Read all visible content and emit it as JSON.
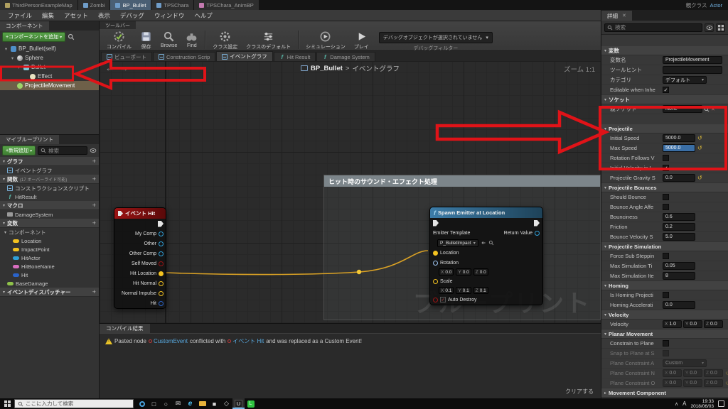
{
  "axis_labels": [
    "X",
    "Y",
    "Z"
  ],
  "titlebar": {
    "tabs": [
      {
        "label": "ThirdPersonExampleMap",
        "active": false,
        "icon_color": "#b0a060"
      },
      {
        "label": "Zombi",
        "active": false,
        "icon_color": "#6f9cc8"
      },
      {
        "label": "BP_Bullet",
        "active": true,
        "icon_color": "#6f9cc8"
      },
      {
        "label": "TPSChara",
        "active": false,
        "icon_color": "#6f9cc8"
      },
      {
        "label": "TPSChara_AnimBP",
        "active": false,
        "icon_color": "#c47ab0"
      }
    ],
    "parent_class_label": "親クラス",
    "parent_class_value": "Actor"
  },
  "menubar": {
    "items": [
      "ファイル",
      "編集",
      "アセット",
      "表示",
      "デバッグ",
      "ウィンドウ",
      "ヘルプ"
    ]
  },
  "components_panel": {
    "tab": "コンポーネント",
    "add_button": "+コンポーネントを追加",
    "tree": [
      {
        "label": "BP_Bullet(self)",
        "indent": 0,
        "icon": "blueprint",
        "arrow": true,
        "selected": false
      },
      {
        "label": "Sphere",
        "indent": 1,
        "icon": "sphere",
        "arrow": true,
        "selected": false
      },
      {
        "label": "Bullet",
        "indent": 2,
        "icon": "mesh",
        "arrow": true,
        "selected": false
      },
      {
        "label": "Effect",
        "indent": 3,
        "icon": "particle",
        "arrow": false,
        "selected": false
      },
      {
        "label": "ProjectileMovement",
        "indent": 1,
        "icon": "movement",
        "arrow": false,
        "selected": true
      }
    ]
  },
  "my_blueprint": {
    "tab": "マイブループリント",
    "add_button": "+新規追加",
    "search_placeholder": "検索",
    "sections": [
      {
        "title": "グラフ",
        "hint": "",
        "items": [
          {
            "label": "イベントグラフ",
            "kind": "graph"
          }
        ]
      },
      {
        "title": "関数",
        "hint": "(17 オーバーライド可能)",
        "items": [
          {
            "label": "コンストラクションスクリプト",
            "kind": "graph"
          },
          {
            "label": "HitResult",
            "kind": "fn"
          }
        ]
      },
      {
        "title": "マクロ",
        "hint": "",
        "items": [
          {
            "label": "DamageSystem",
            "kind": "macro"
          }
        ]
      },
      {
        "title": "変数",
        "hint": "",
        "items": [
          {
            "label": "コンポーネント",
            "kind": "category"
          },
          {
            "label": "Location",
            "kind": "pill",
            "color": "#f3c220",
            "indent": 1
          },
          {
            "label": "ImpactPoint",
            "kind": "pill",
            "color": "#f3c220",
            "indent": 1
          },
          {
            "label": "HitActor",
            "kind": "pill",
            "color": "#2e9fd8",
            "indent": 1
          },
          {
            "label": "HitBoneName",
            "kind": "pill",
            "color": "#d86ec0",
            "indent": 1
          },
          {
            "label": "Hit",
            "kind": "pill",
            "color": "#2a63c9",
            "indent": 1
          },
          {
            "label": "BaseDamage",
            "kind": "pill",
            "color": "#8fc24a",
            "indent": 0
          }
        ]
      },
      {
        "title": "イベントディスパッチャー",
        "hint": "",
        "items": []
      }
    ]
  },
  "toolbar": {
    "tab": "ツールバー",
    "groups": [
      [
        {
          "label": "コンパイル",
          "icon": "compile"
        },
        {
          "label": "保存",
          "icon": "save"
        },
        {
          "label": "Browse",
          "icon": "browse"
        },
        {
          "label": "Find",
          "icon": "find"
        }
      ],
      [
        {
          "label": "クラス設定",
          "icon": "settings"
        },
        {
          "label": "クラスのデフォルト",
          "icon": "defaults"
        }
      ],
      [
        {
          "label": "シミュレーション",
          "icon": "simulate"
        },
        {
          "label": "プレイ",
          "icon": "play"
        }
      ]
    ],
    "debug_dropdown": "デバッグオブジェクトが選択されていません",
    "debug_label": "デバッグフィルター"
  },
  "doc_tabs": [
    {
      "label": "ビューポート",
      "kind": "viewport",
      "active": false
    },
    {
      "label": "Construction Scrip",
      "kind": "graph",
      "active": false
    },
    {
      "label": "イベントグラフ",
      "kind": "graph",
      "active": true
    },
    {
      "label": "Hit Result",
      "kind": "fn",
      "active": false
    },
    {
      "label": "Damage System",
      "kind": "fn",
      "active": false
    }
  ],
  "graph": {
    "breadcrumb": {
      "root": "BP_Bullet",
      "sep": ">",
      "current": "イベントグラフ"
    },
    "zoom_label": "ズーム 1:1",
    "watermark": "ブループリント",
    "comment_title": "ヒット時のサウンド・エフェクト処理",
    "event_node": {
      "title": "イベント Hit",
      "pins": [
        "My Comp",
        "Other",
        "Other Comp",
        "Self Moved",
        "Hit Location",
        "Hit Normal",
        "Normal Impulse",
        "Hit"
      ],
      "pin_colors": [
        "obj",
        "obj",
        "obj",
        "bool",
        "vec",
        "vec",
        "vec",
        "struct"
      ],
      "connected": [
        false,
        false,
        false,
        false,
        true,
        false,
        false,
        false
      ]
    },
    "spawn_node": {
      "title": "Spawn Emitter at Location",
      "emitter_label": "Emitter Template",
      "emitter_value": "P_BulletImpact",
      "return_label": "Return Value",
      "location_label": "Location",
      "rotation_label": "Rotation",
      "rotation": {
        "x": "0.0",
        "y": "0.0",
        "z": "0.0"
      },
      "scale_label": "Scale",
      "scale": {
        "x": "0.1",
        "y": "0.1",
        "z": "0.1"
      },
      "auto_destroy_label": "Auto Destroy"
    }
  },
  "compile_results": {
    "tab": "コンパイル結果",
    "message": {
      "prefix": "Pasted node ",
      "link1": "CustomEvent",
      "middle": " conflicted with ",
      "link2": "イベント Hit",
      "suffix": " and was replaced as a Custom Event!"
    },
    "clear_button": "クリアする"
  },
  "details": {
    "tab": "詳細",
    "search_placeholder": "検索",
    "sections": [
      {
        "title": "変数",
        "gap": 0,
        "collapsed": false,
        "rows": [
          {
            "label": "変数名",
            "type": "text",
            "value": "ProjectileMovement"
          },
          {
            "label": "ツールヒント",
            "type": "text",
            "value": ""
          },
          {
            "label": "カテゴリ",
            "type": "select",
            "value": "デフォルト"
          },
          {
            "label": "Editable when Inhe",
            "type": "check",
            "checked": true
          }
        ]
      },
      {
        "title": "ソケット",
        "gap": 14,
        "collapsed": false,
        "rows": [
          {
            "label": "親ソケット",
            "type": "socket",
            "value": "None"
          }
        ]
      },
      {
        "title": "Projectile",
        "gap": 0,
        "collapsed": false,
        "rows": [
          {
            "label": "Initial Speed",
            "type": "num",
            "value": "5000.0",
            "reset": true
          },
          {
            "label": "Max Speed",
            "type": "num",
            "value": "5000.0",
            "reset": true,
            "selected": true
          },
          {
            "label": "Rotation Follows V",
            "type": "check",
            "checked": false
          },
          {
            "label": "Initial Velocity in L",
            "type": "check",
            "checked": true
          },
          {
            "label": "Projectile Gravity S",
            "type": "num",
            "value": "0.0",
            "reset": true
          }
        ]
      },
      {
        "title": "Projectile Bounces",
        "gap": 0,
        "collapsed": false,
        "rows": [
          {
            "label": "Should Bounce",
            "type": "check",
            "checked": false
          },
          {
            "label": "Bounce Angle Affe",
            "type": "check",
            "checked": false
          },
          {
            "label": "Bounciness",
            "type": "num",
            "value": "0.6"
          },
          {
            "label": "Friction",
            "type": "num",
            "value": "0.2"
          },
          {
            "label": "Bounce Velocity S",
            "type": "num",
            "value": "5.0"
          }
        ]
      },
      {
        "title": "Projectile Simulation",
        "gap": 0,
        "collapsed": false,
        "rows": [
          {
            "label": "Force Sub Steppin",
            "type": "check",
            "checked": false
          },
          {
            "label": "Max Simulation Ti",
            "type": "num",
            "value": "0.05"
          },
          {
            "label": "Max Simulation Ite",
            "type": "num",
            "value": "8"
          }
        ]
      },
      {
        "title": "Homing",
        "gap": 0,
        "collapsed": false,
        "rows": [
          {
            "label": "Is Homing Projecti",
            "type": "check",
            "checked": false
          },
          {
            "label": "Homing Accelerati",
            "type": "num",
            "value": "0.0"
          }
        ]
      },
      {
        "title": "Velocity",
        "gap": 0,
        "collapsed": false,
        "rows": [
          {
            "label": "Velocity",
            "type": "vec3",
            "x": "1.0",
            "y": "0.0",
            "z": "0.0"
          }
        ]
      },
      {
        "title": "Planar Movement",
        "gap": 0,
        "collapsed": false,
        "rows": [
          {
            "label": "Constrain to Plane",
            "type": "check",
            "checked": false
          },
          {
            "label": "Snap to Plane at S",
            "type": "check",
            "checked": false,
            "dim": true
          },
          {
            "label": "Plane Constraint A",
            "type": "select",
            "value": "Custom",
            "dim": true
          },
          {
            "label": "Plane Constraint N",
            "type": "vec3",
            "x": "0.0",
            "y": "0.0",
            "z": "0.0",
            "dim": true,
            "reset": true
          },
          {
            "label": "Plane Constraint O",
            "type": "vec3",
            "x": "0.0",
            "y": "0.0",
            "z": "0.0",
            "dim": true,
            "reset": true
          }
        ]
      },
      {
        "title": "Movement Component",
        "gap": 0,
        "collapsed": true,
        "rows": []
      }
    ]
  },
  "taskbar": {
    "search_placeholder": "ここに入力して検索",
    "icons": [
      {
        "name": "cortana",
        "kind": "ring"
      },
      {
        "name": "task-view",
        "kind": "glyph",
        "glyph": "□"
      },
      {
        "name": "people",
        "kind": "glyph",
        "glyph": "○"
      },
      {
        "name": "mail",
        "kind": "glyph",
        "glyph": "✉"
      },
      {
        "name": "edge-browser",
        "kind": "edge"
      },
      {
        "name": "file-explorer",
        "kind": "folder"
      },
      {
        "name": "store",
        "kind": "glyph",
        "glyph": "■"
      },
      {
        "name": "visual-studio",
        "kind": "glyph",
        "glyph": "◇"
      },
      {
        "name": "unreal-editor",
        "kind": "unreal",
        "glyph": "U",
        "active": true
      },
      {
        "name": "line-app",
        "kind": "green",
        "glyph": "L"
      }
    ],
    "ime": "A",
    "clock_time": "19:33",
    "clock_date": "2018/06/03"
  }
}
